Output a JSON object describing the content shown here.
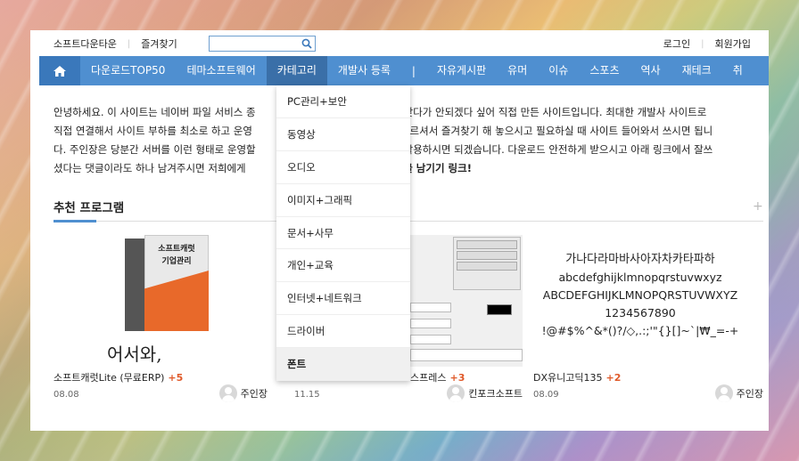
{
  "topbar": {
    "left_links": [
      "소프트다운타운",
      "즐겨찾기"
    ],
    "search_placeholder": "",
    "right_links": [
      "로그인",
      "회원가입"
    ]
  },
  "nav": {
    "items": [
      "다운로드TOP50",
      "테마소프트웨어",
      "카테고리",
      "개발사 등록",
      "|",
      "자유게시판",
      "유머",
      "이슈",
      "스포츠",
      "역사",
      "재테크",
      "취"
    ]
  },
  "intro": {
    "line1": "안녕하세요. 이 사이트는 네이버 파일 서비스 종",
    "line1b": "찾다가 안되겠다 싶어 직접 만든 사이트입니다. 최대한 개발사 사이트로",
    "line2": "직접 연결해서 사이트 부하를 최소로 하고 운영",
    "line2b": "누르셔서 즐겨찾기 해 놓으시고 필요하실 때 사이트 들어와서 쓰시면 됩니",
    "line3": "다. 주인장은 당분간 서버를 이런 형태로 운영할",
    "line3b": "활용하시면 되겠습니다. 다운로드 안전하게 받으시고 아래 링크에서 잘쓰",
    "line4": "셨다는 댓글이라도 하나 남겨주시면 저희에게",
    "line4b": "댓글 남기기 링크!"
  },
  "section": {
    "title": "추천 프로그램",
    "more": "+"
  },
  "cards": [
    {
      "title": "소프트캐럿Lite (무료ERP)",
      "count": "+5",
      "date": "08.08",
      "author": "주인장",
      "box_line1": "소프트캐럿",
      "box_line2": "기업관리",
      "welcome": "어서와,"
    },
    {
      "title": "스프레스",
      "count": "+3",
      "date": "11.15",
      "author": "킨포크소프트"
    },
    {
      "title": "DX유니고딕135",
      "count": "+2",
      "date": "08.09",
      "author": "주인장",
      "sample": [
        "가나다라마바사아자차카타파하",
        "abcdefghijklmnopqrstuvwxyz",
        "ABCDEFGHIJKLMNOPQRSTUVWXYZ",
        "1234567890",
        "!@#$%^&*()?/◇,.:;'\"{}[]~`|₩_=-+"
      ]
    }
  ],
  "dropdown": {
    "items": [
      "PC관리+보안",
      "동영상",
      "오디오",
      "이미지+그래픽",
      "문서+사무",
      "개인+교육",
      "인터넷+네트워크",
      "드라이버",
      "폰트"
    ]
  },
  "colors": {
    "nav": "#4f8fd0",
    "accent_count": "#e05a2a"
  }
}
